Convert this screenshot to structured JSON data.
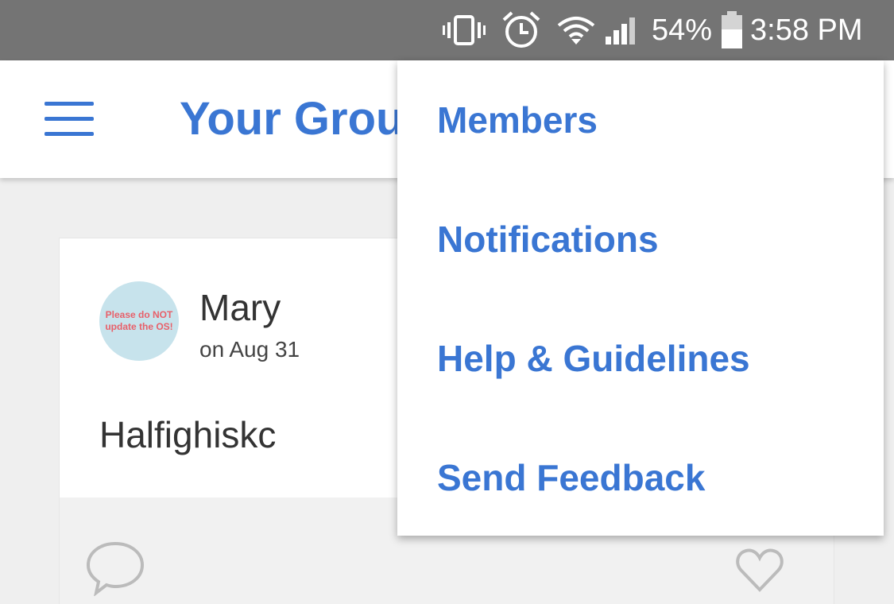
{
  "status_bar": {
    "battery_percent": "54%",
    "time": "3:58 PM",
    "icons": [
      "vibrate-icon",
      "alarm-icon",
      "wifi-icon",
      "signal-icon",
      "battery-icon"
    ]
  },
  "app_bar": {
    "title": "Your Grou"
  },
  "post": {
    "avatar_text": "Please do NOT update the OS!",
    "author": "Mary",
    "date": "on Aug 31",
    "body": "Halfighiskc"
  },
  "menu": {
    "items": [
      {
        "label": "Members"
      },
      {
        "label": "Notifications"
      },
      {
        "label": "Help & Guidelines"
      },
      {
        "label": "Send Feedback"
      }
    ]
  },
  "colors": {
    "accent": "#3a76d3",
    "status_bar": "#747474",
    "background": "#efefef"
  }
}
